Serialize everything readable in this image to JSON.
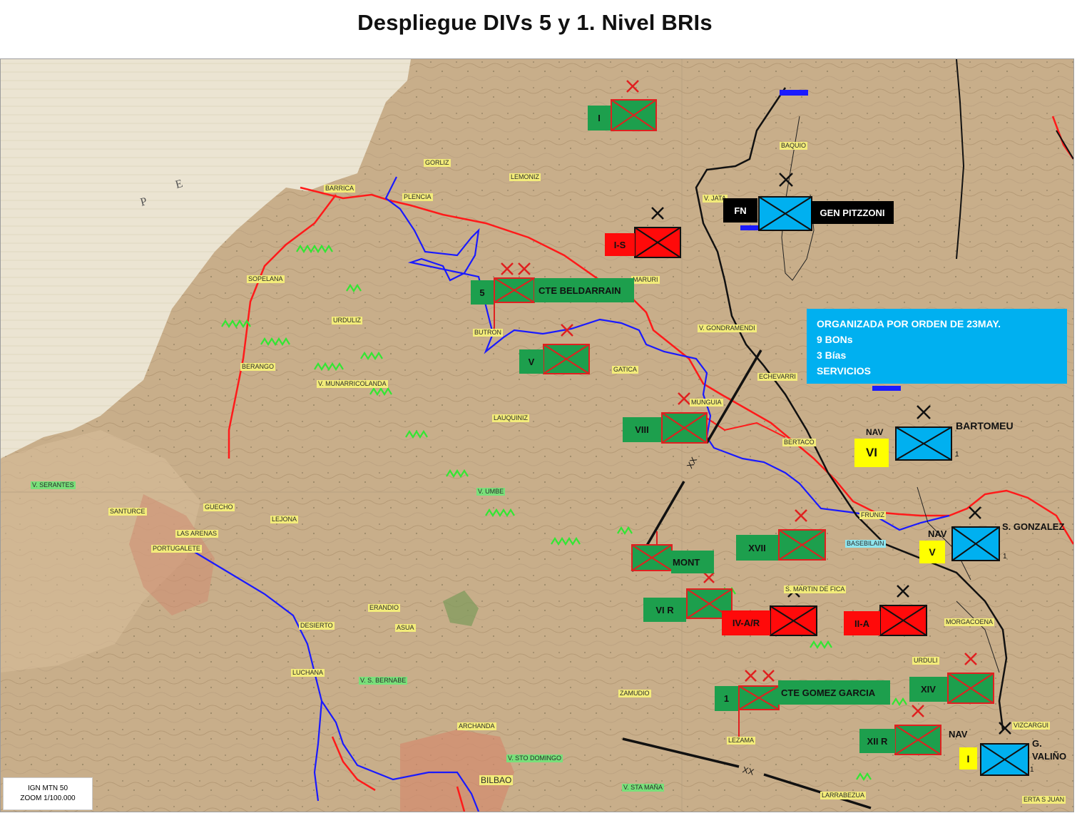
{
  "title": "Despliegue DIVs 5 y 1. Nivel BRIs",
  "colors": {
    "nationalist_green": "#1d9f4d",
    "republican_red": "#ff0a0a",
    "navarra_cyan": "#00b0f0",
    "navarra_yellow": "#ffff00",
    "front_line": "#ff1a1a",
    "river": "#1a1aff",
    "map_land": "#c9b18e",
    "sea": "#e8e1cd"
  },
  "info_box": {
    "line1": "ORGANIZADA POR ORDEN DE 23MAY.",
    "line2": "9 BONs",
    "line3": "3 Bías",
    "line4": "SERVICIOS"
  },
  "source": {
    "line1": "IGN MTN 50",
    "line2": "ZOOM 1/100.000"
  },
  "places": {
    "gorliz": "GORLIZ",
    "lemoniz": "LEMONIZ",
    "barrica": "BARRICA",
    "plencia": "PLENCIA",
    "maruri": "MARURI",
    "sopelana": "SOPELANA",
    "urduliz": "URDULIZ",
    "butron": "BUTRON",
    "berango": "BERANGO",
    "munarricolanda": "V. MUNARRICOLANDA",
    "gatica": "GATICA",
    "lauquiniz": "LAUQUINIZ",
    "jata": "V. JATA",
    "baquio": "BAQUIO",
    "gondramendi": "V. GONDRAMENDI",
    "echevarri": "ECHEVARRI",
    "munguia": "MUNGUIA",
    "bertaco": "BERTACO",
    "fruniz": "FRUNIZ",
    "basebilain": "BASEBILAIN",
    "serantes": "V. SERANTES",
    "santurce": "SANTURCE",
    "guecho": "GUECHO",
    "lejona": "LEJONA",
    "umbe": "V. UMBE",
    "las_arenas": "LAS ARENAS",
    "portugalete": "PORTUGALETE",
    "erandio": "ERANDIO",
    "desierto": "DESIERTO",
    "asua": "ASUA",
    "luchana": "LUCHANA",
    "s_bernabe": "V. S. BERNABE",
    "zamudio": "ZAMUDIO",
    "archanda": "ARCHANDA",
    "sto_domingo": "V. STO DOMINGO",
    "bilbao": "BILBAO",
    "sta_marina": "V. STA MAÑA",
    "lezama": "LEZAMA",
    "larrabezua": "LARRABEZUA",
    "s_martin_fica": "S. MARTIN DE FICA",
    "morgacoena": "MORGACOENA",
    "urduli": "URDULI",
    "vizcargui": "VIZCARGUI",
    "errta_s_juan": "ERTA S JUAN"
  },
  "units": {
    "i_top": "I",
    "is": "I-S",
    "fn": "FN",
    "gen_pitzzoni": "GEN PITZZONI",
    "div5": "5",
    "cte_beldarrain": "CTE BELDARRAIN",
    "v_left": "V",
    "viii": "VIII",
    "xx_upper": "XX",
    "nav_vi": "NAV",
    "vi_yellow": "VI",
    "bartomeu": "BARTOMEU",
    "one_vi": "1",
    "xvii": "XVII",
    "nav_v": "NAV",
    "v_yellow": "V",
    "s_gonzalez": "S. GONZALEZ",
    "one_v": "1",
    "mont": "MONT",
    "vi_r": "VI R",
    "iv_ar": "IV-A/R",
    "ii_a": "II-A",
    "div1": "1",
    "cte_gomez_garcia": "CTE GOMEZ GARCIA",
    "xiv": "XIV",
    "xii_r": "XII R",
    "nav_i": "NAV",
    "i_yellow": "I",
    "g_valino": "G. VALIÑO",
    "one_i": "1",
    "xx_lower": "XX"
  },
  "map_marks": {
    "sea_letter_p": "P",
    "sea_letter_e": "E"
  }
}
